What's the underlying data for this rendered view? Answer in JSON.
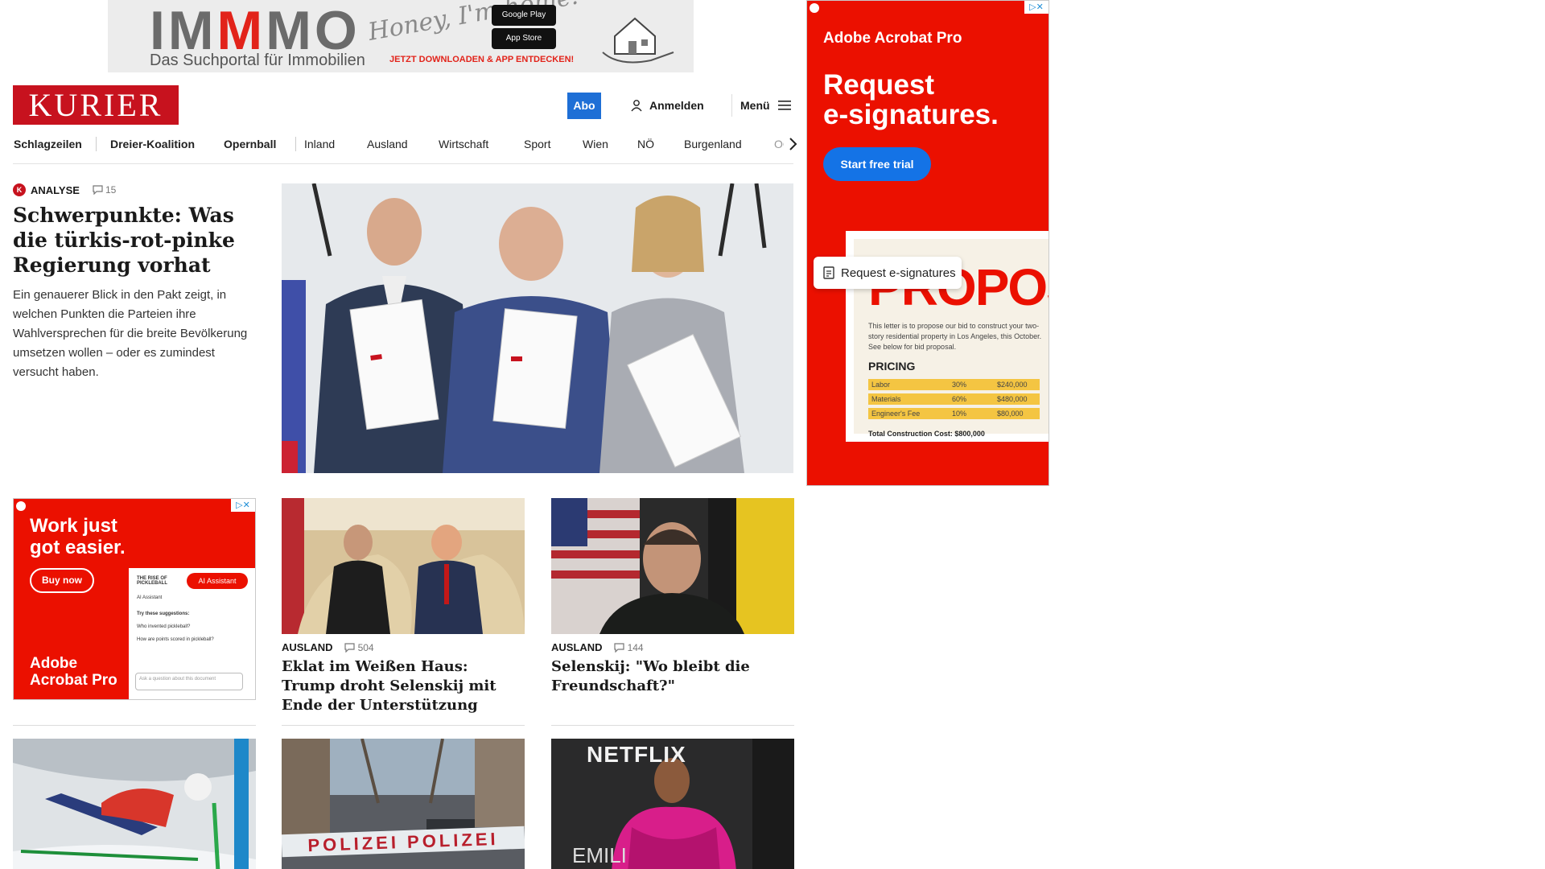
{
  "top_ad": {
    "logo_pre": "IM",
    "logo_m": "M",
    "logo_post": "MO",
    "tagline": "Das Suchportal für Immobilien",
    "script": "Honey, I'm home!",
    "google_play": "Google Play",
    "app_store": "App Store",
    "cta": "JETZT DOWNLOADEN & APP ENTDECKEN!"
  },
  "header": {
    "logo": "KURIER",
    "abo": "Abo",
    "login": "Anmelden",
    "menu": "Menü"
  },
  "nav": [
    {
      "label": "Schlagzeilen",
      "bold": true
    },
    {
      "label": "Dreier-Koalition",
      "bold": true
    },
    {
      "label": "Opernball",
      "bold": true
    },
    {
      "label": "Inland",
      "bold": false
    },
    {
      "label": "Ausland",
      "bold": false
    },
    {
      "label": "Wirtschaft",
      "bold": false
    },
    {
      "label": "Sport",
      "bold": false
    },
    {
      "label": "Wien",
      "bold": false
    },
    {
      "label": "NÖ",
      "bold": false
    },
    {
      "label": "Burgenland",
      "bold": false
    },
    {
      "label": "OÖ",
      "bold": false
    }
  ],
  "lead": {
    "badge": "K",
    "kicker": "ANALYSE",
    "comments": "15",
    "title": "Schwerpunkte: Was die türkis-rot-pinke Regierung vorhat",
    "teaser": "Ein genauerer Blick in den Pakt zeigt, in welchen Punkten die Parteien ihre Wahlversprechen für die breite Bevölkerung umsetzen wollen – oder es zumindest versucht haben."
  },
  "cards": [
    {
      "kicker": "AUSLAND",
      "comments": "504",
      "title": "Eklat im Weißen Haus: Trump droht Selenskij mit Ende der Unterstützung"
    },
    {
      "kicker": "AUSLAND",
      "comments": "144",
      "title": "Selenskij: \"Wo bleibt die Freundschaft?\""
    }
  ],
  "tiles": {
    "police_tape": "POLIZEI POLIZEI",
    "netflix": "NETFLIX",
    "emilia": "EMILI"
  },
  "ad_small": {
    "headline_1": "Work just",
    "headline_2": "got easier.",
    "button": "Buy now",
    "brand_1": "Adobe",
    "brand_2": "Acrobat Pro",
    "pill": "AI Assistant",
    "doc_title": "THE RISE OF PICKLEBALL",
    "line1": "AI Assistant",
    "line2": "Try these suggestions:",
    "line3": "Who invented pickleball?",
    "line4": "How are points scored in pickleball?",
    "input": "Ask a question about this document"
  },
  "ad_right": {
    "brand": "Adobe Acrobat Pro",
    "headline_1": "Request",
    "headline_2": "e-signatures.",
    "cta": "Start free trial",
    "doc_big": "PROPOSAL",
    "doc_para": "This letter is to propose our bid to construct your two-story residential property in Los Angeles, this October. See below for bid proposal.",
    "pricing": "PRICING",
    "rows": [
      {
        "label": "Labor",
        "pct": "30%",
        "amount": "$240,000"
      },
      {
        "label": "Materials",
        "pct": "60%",
        "amount": "$480,000"
      },
      {
        "label": "Engineer's Fee",
        "pct": "10%",
        "amount": "$80,000"
      }
    ],
    "total": "Total Construction Cost: $800,000",
    "esig": "Request e-signatures"
  },
  "colors": {
    "brand_red": "#c7121e",
    "abo_blue": "#1e6fd6",
    "adobe_red": "#eb1000",
    "adobe_blue": "#1473e6"
  }
}
